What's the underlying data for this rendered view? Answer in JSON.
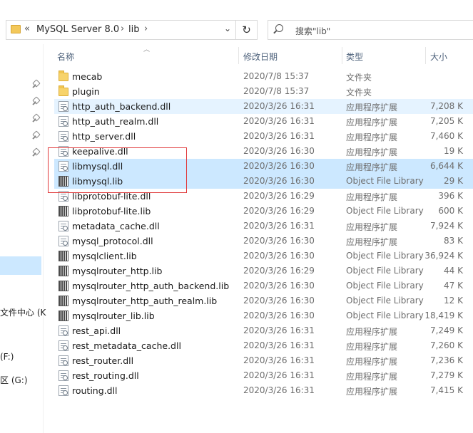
{
  "address_bar": {
    "overflow_glyph": "«",
    "crumbs": [
      "MySQL Server 8.0",
      "lib"
    ],
    "dropdown_glyph": "⌄",
    "refresh_glyph": "↻"
  },
  "search": {
    "placeholder": "搜索\"lib\""
  },
  "nav": {
    "items": [
      "文件中心 (K",
      "(F:)",
      "区 (G:)"
    ]
  },
  "columns": {
    "name": "名称",
    "modified": "修改日期",
    "type": "类型",
    "size": "大小"
  },
  "files": [
    {
      "name": "mecab",
      "date": "2020/7/8 15:37",
      "type": "文件夹",
      "size": "",
      "icon": "folder-icon",
      "state": "normal"
    },
    {
      "name": "plugin",
      "date": "2020/7/8 15:37",
      "type": "文件夹",
      "size": "",
      "icon": "folder-icon",
      "state": "normal"
    },
    {
      "name": "http_auth_backend.dll",
      "date": "2020/3/26 16:31",
      "type": "应用程序扩展",
      "size": "7,208 K",
      "icon": "dll-icon",
      "state": "hover"
    },
    {
      "name": "http_auth_realm.dll",
      "date": "2020/3/26 16:31",
      "type": "应用程序扩展",
      "size": "7,205 K",
      "icon": "dll-icon",
      "state": "normal"
    },
    {
      "name": "http_server.dll",
      "date": "2020/3/26 16:31",
      "type": "应用程序扩展",
      "size": "7,460 K",
      "icon": "dll-icon",
      "state": "normal"
    },
    {
      "name": "keepalive.dll",
      "date": "2020/3/26 16:30",
      "type": "应用程序扩展",
      "size": "19 K",
      "icon": "dll-icon",
      "state": "normal"
    },
    {
      "name": "libmysql.dll",
      "date": "2020/3/26 16:30",
      "type": "应用程序扩展",
      "size": "6,644 K",
      "icon": "dll-icon",
      "state": "selected"
    },
    {
      "name": "libmysql.lib",
      "date": "2020/3/26 16:30",
      "type": "Object File Library",
      "size": "29 K",
      "icon": "lib-icon",
      "state": "selected"
    },
    {
      "name": "libprotobuf-lite.dll",
      "date": "2020/3/26 16:29",
      "type": "应用程序扩展",
      "size": "396 K",
      "icon": "dll-icon",
      "state": "normal"
    },
    {
      "name": "libprotobuf-lite.lib",
      "date": "2020/3/26 16:29",
      "type": "Object File Library",
      "size": "600 K",
      "icon": "lib-icon",
      "state": "normal"
    },
    {
      "name": "metadata_cache.dll",
      "date": "2020/3/26 16:31",
      "type": "应用程序扩展",
      "size": "7,924 K",
      "icon": "dll-icon",
      "state": "normal"
    },
    {
      "name": "mysql_protocol.dll",
      "date": "2020/3/26 16:30",
      "type": "应用程序扩展",
      "size": "83 K",
      "icon": "dll-icon",
      "state": "normal"
    },
    {
      "name": "mysqlclient.lib",
      "date": "2020/3/26 16:30",
      "type": "Object File Library",
      "size": "36,924 K",
      "icon": "lib-icon",
      "state": "normal"
    },
    {
      "name": "mysqlrouter_http.lib",
      "date": "2020/3/26 16:29",
      "type": "Object File Library",
      "size": "44 K",
      "icon": "lib-icon",
      "state": "normal"
    },
    {
      "name": "mysqlrouter_http_auth_backend.lib",
      "date": "2020/3/26 16:30",
      "type": "Object File Library",
      "size": "47 K",
      "icon": "lib-icon",
      "state": "normal"
    },
    {
      "name": "mysqlrouter_http_auth_realm.lib",
      "date": "2020/3/26 16:30",
      "type": "Object File Library",
      "size": "12 K",
      "icon": "lib-icon",
      "state": "normal"
    },
    {
      "name": "mysqlrouter_lib.lib",
      "date": "2020/3/26 16:30",
      "type": "Object File Library",
      "size": "18,419 K",
      "icon": "lib-icon",
      "state": "normal"
    },
    {
      "name": "rest_api.dll",
      "date": "2020/3/26 16:31",
      "type": "应用程序扩展",
      "size": "7,249 K",
      "icon": "dll-icon",
      "state": "normal"
    },
    {
      "name": "rest_metadata_cache.dll",
      "date": "2020/3/26 16:31",
      "type": "应用程序扩展",
      "size": "7,260 K",
      "icon": "dll-icon",
      "state": "normal"
    },
    {
      "name": "rest_router.dll",
      "date": "2020/3/26 16:31",
      "type": "应用程序扩展",
      "size": "7,236 K",
      "icon": "dll-icon",
      "state": "normal"
    },
    {
      "name": "rest_routing.dll",
      "date": "2020/3/26 16:31",
      "type": "应用程序扩展",
      "size": "7,279 K",
      "icon": "dll-icon",
      "state": "normal"
    },
    {
      "name": "routing.dll",
      "date": "2020/3/26 16:31",
      "type": "应用程序扩展",
      "size": "7,415 K",
      "icon": "dll-icon",
      "state": "normal"
    }
  ],
  "colors": {
    "selection": "#cce8ff",
    "hover": "#e5f3ff",
    "annotation_box": "#e0393b",
    "header_text": "#4c607a"
  }
}
